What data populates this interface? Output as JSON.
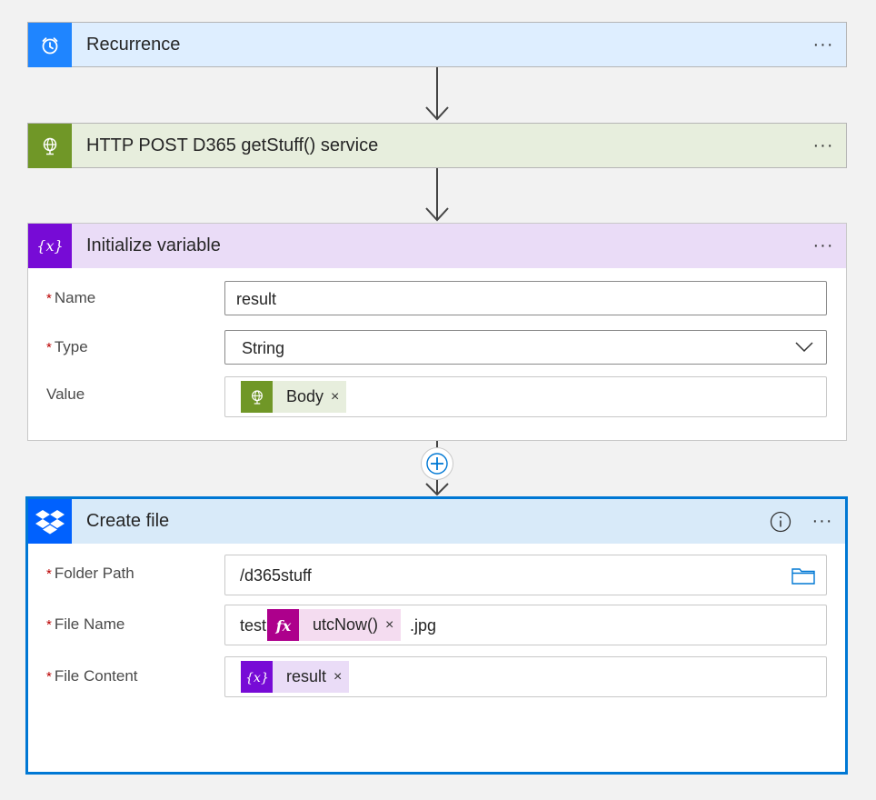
{
  "steps": {
    "recurrence": {
      "title": "Recurrence",
      "more": "···"
    },
    "http": {
      "title": "HTTP POST D365 getStuff() service",
      "more": "···"
    },
    "init_var": {
      "title": "Initialize variable",
      "more": "···",
      "name_label": "Name",
      "name_value": "result",
      "type_label": "Type",
      "type_value": "String",
      "value_label": "Value",
      "value_token": "Body"
    },
    "create_file": {
      "title": "Create file",
      "more": "···",
      "folder_label": "Folder Path",
      "folder_value": "/d365stuff",
      "filename_label": "File Name",
      "filename_prefix": "test",
      "filename_token": "utcNow()",
      "filename_suffix": ".jpg",
      "content_label": "File Content",
      "content_token": "result"
    }
  },
  "required_mark": "*",
  "token_close": "×",
  "colors": {
    "recurrence": "#1f85ff",
    "http": "#709727",
    "variable": "#770bd6",
    "expression": "#ad008c",
    "dropbox": "#0061fe",
    "selected_border": "#0078d4"
  }
}
